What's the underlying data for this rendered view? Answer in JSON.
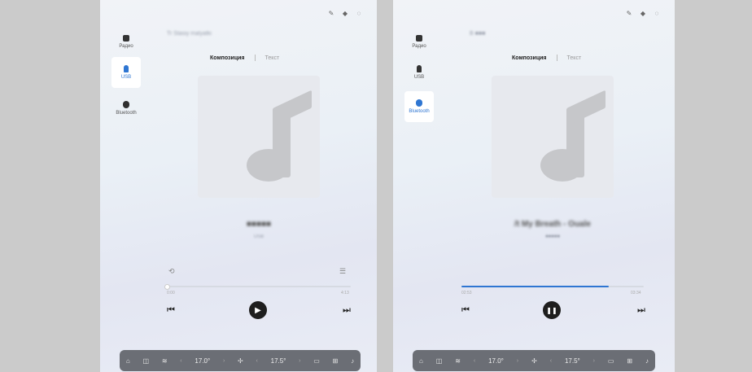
{
  "left": {
    "sidebar": [
      {
        "label": "Радио",
        "icon": "radio-icon"
      },
      {
        "label": "USB",
        "icon": "usb-icon"
      },
      {
        "label": "Bluetooth",
        "icon": "bluetooth-icon"
      }
    ],
    "source_title": "Tr Stasiy malyatki",
    "tabs": {
      "active": "Композиция",
      "inactive": "Текст"
    },
    "song_title": "■■■■■",
    "song_artist": "USB",
    "time_elapsed": "0:00",
    "time_total": "4:13",
    "progress": 0.0,
    "play_icon": "▶",
    "bottom": {
      "temp_left": "17.0°",
      "temp_right": "17.5°"
    }
  },
  "right": {
    "sidebar": [
      {
        "label": "Радио",
        "icon": "radio-icon"
      },
      {
        "label": "USB",
        "icon": "usb-icon"
      },
      {
        "label": "Bluetooth",
        "icon": "bluetooth-icon"
      }
    ],
    "source_title": "B ■■■",
    "tabs": {
      "active": "Композиция",
      "inactive": "Текст"
    },
    "song_title": "/t My Breath - Ouale",
    "song_artist": "■■■■■",
    "time_elapsed": "02:53",
    "time_total": "03:34",
    "progress": 0.81,
    "pause_icon": "❚❚",
    "bottom": {
      "temp_left": "17.0°",
      "temp_right": "17.5°"
    }
  },
  "status_icons": [
    "edit-icon",
    "location-icon",
    "cast-icon"
  ],
  "colors": {
    "accent": "#2f76d2",
    "bar": "#6b6e75"
  }
}
